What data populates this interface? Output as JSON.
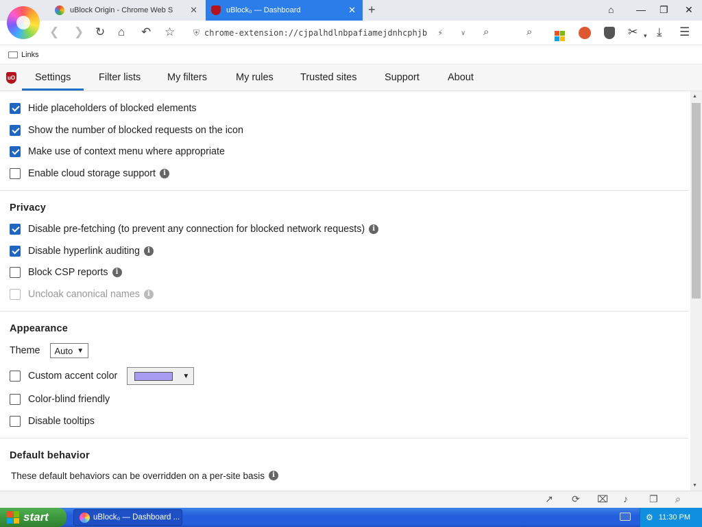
{
  "browser": {
    "tabs": [
      {
        "title": "uBlock Origin - Chrome Web S",
        "close": "✕"
      },
      {
        "title": "uBlock₀ — Dashboard",
        "close": "✕"
      }
    ],
    "new_tab": "+",
    "url": "chrome-extension://cjpalhdlnbpafiamejdnhcphjb",
    "bookmarks": [
      {
        "label": "Links"
      }
    ],
    "accent": "#2b7de9"
  },
  "ublock_nav": {
    "logo_text": "uO",
    "tabs": [
      {
        "label": "Settings",
        "active": true
      },
      {
        "label": "Filter lists"
      },
      {
        "label": "My filters"
      },
      {
        "label": "My rules"
      },
      {
        "label": "Trusted sites"
      },
      {
        "label": "Support"
      },
      {
        "label": "About"
      }
    ]
  },
  "settings": {
    "general": [
      {
        "label": "Hide placeholders of blocked elements",
        "checked": true
      },
      {
        "label": "Show the number of blocked requests on the icon",
        "checked": true
      },
      {
        "label": "Make use of context menu where appropriate",
        "checked": true
      },
      {
        "label": "Enable cloud storage support",
        "checked": false,
        "info": true
      }
    ],
    "privacy": {
      "heading": "Privacy",
      "items": [
        {
          "label": "Disable pre-fetching (to prevent any connection for blocked network requests)",
          "checked": true,
          "info": true
        },
        {
          "label": "Disable hyperlink auditing",
          "checked": true,
          "info": true
        },
        {
          "label": "Block CSP reports",
          "checked": false,
          "info": true
        },
        {
          "label": "Uncloak canonical names",
          "checked": false,
          "info": true,
          "disabled": true
        }
      ]
    },
    "appearance": {
      "heading": "Appearance",
      "theme_label": "Theme",
      "theme_value": "Auto",
      "custom_accent_label": "Custom accent color",
      "accent_swatch": "#a89cf2",
      "colorblind_label": "Color-blind friendly",
      "tooltips_label": "Disable tooltips"
    },
    "default_behavior": {
      "heading": "Default behavior",
      "description": "These default behaviors can be overridden on a per-site basis"
    },
    "info_glyph": "i",
    "select_arrow": "▼"
  },
  "taskbar": {
    "start_label": "start",
    "task_label": "uBlock₀ — Dashboard ...",
    "clock": "11:30 PM"
  }
}
